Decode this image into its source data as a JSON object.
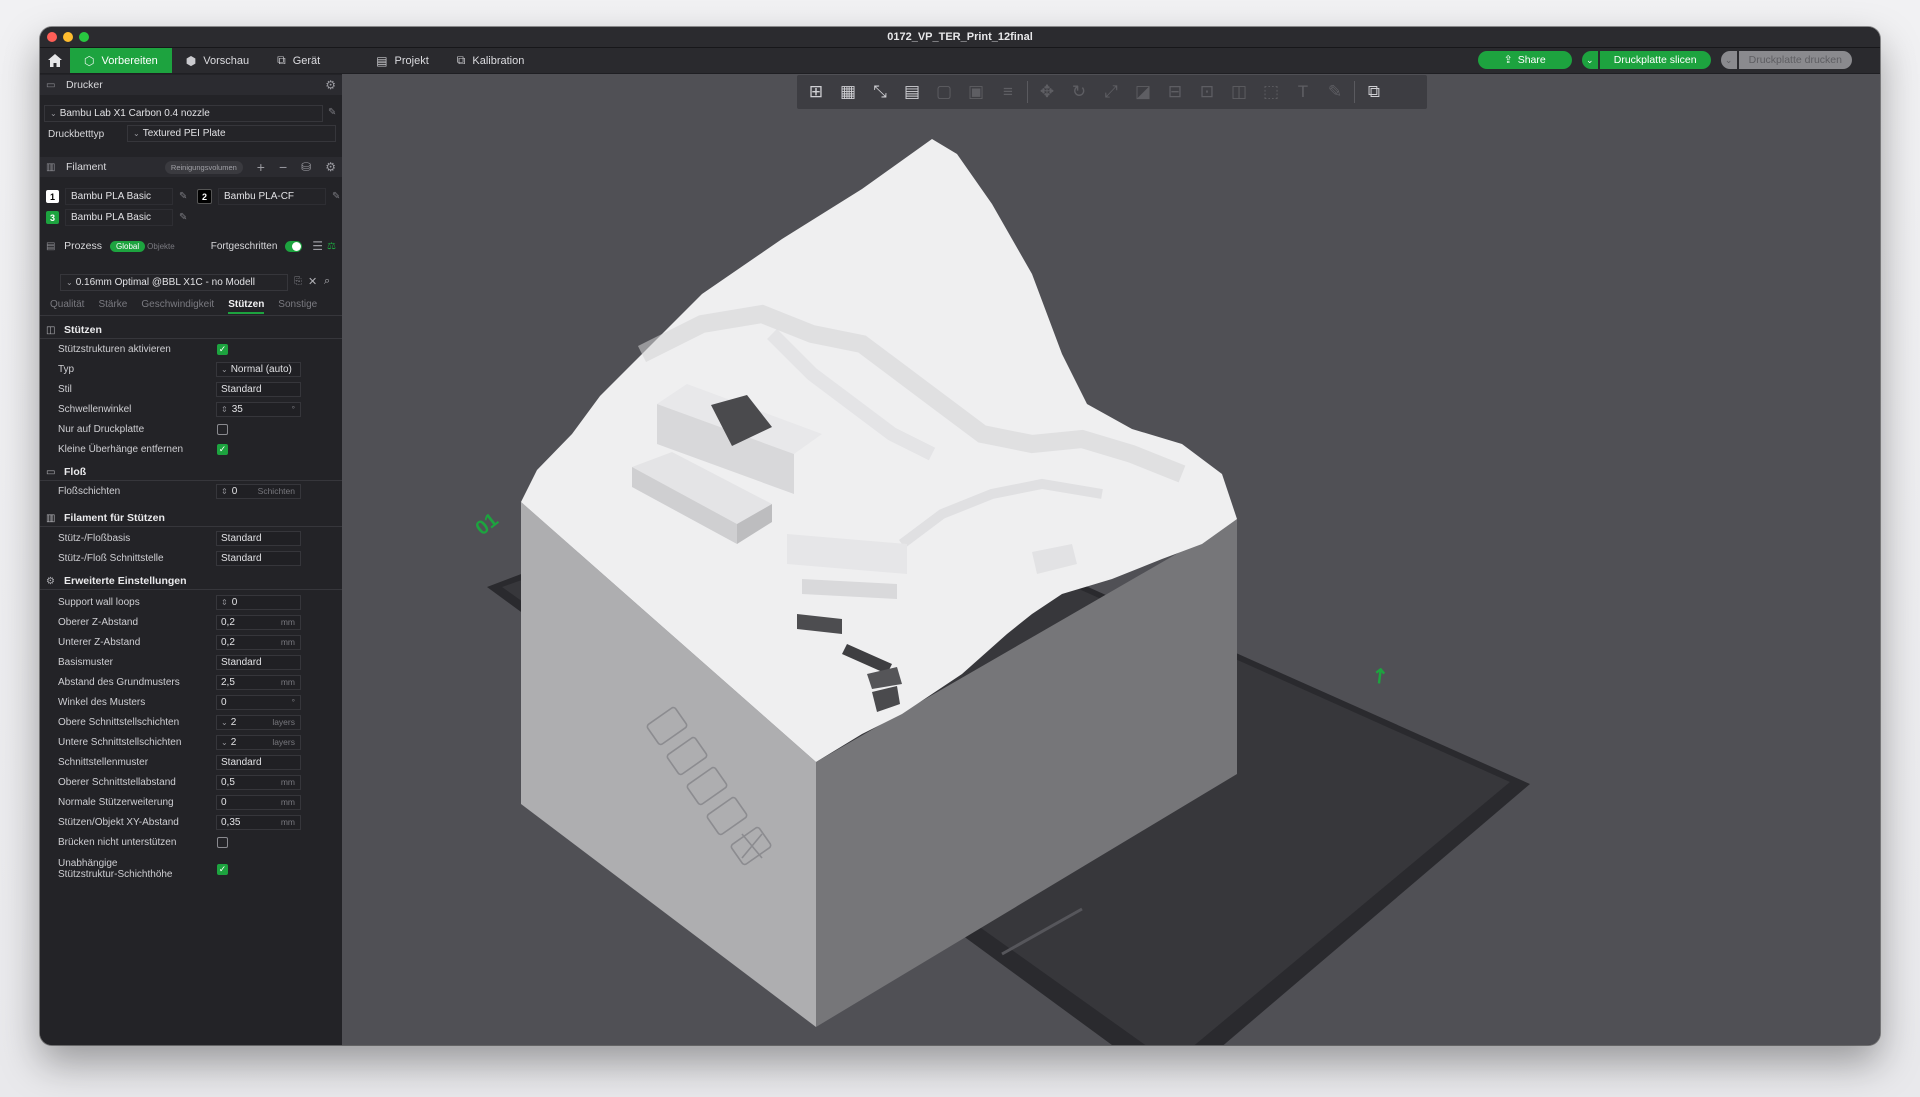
{
  "window": {
    "title": "0172_VP_TER_Print_12final"
  },
  "menu": {
    "tabs": [
      {
        "label": "Vorbereiten",
        "icon": "prepare-icon",
        "active": true
      },
      {
        "label": "Vorschau",
        "icon": "preview-icon"
      },
      {
        "label": "Gerät",
        "icon": "device-icon"
      },
      {
        "label": "Projekt",
        "icon": "project-icon"
      },
      {
        "label": "Kalibration",
        "icon": "calibration-icon"
      }
    ],
    "share": "Share",
    "slice": "Druckplatte slicen",
    "print": "Druckplatte drucken"
  },
  "printer": {
    "title": "Drucker",
    "model": "Bambu Lab X1 Carbon 0.4 nozzle",
    "bed_label": "Druckbetttyp",
    "bed_value": "Textured PEI Plate"
  },
  "filament": {
    "title": "Filament",
    "flush_button": "Reinigungsvolumen",
    "slots": [
      {
        "num": "1",
        "name": "Bambu PLA Basic",
        "color": "#ffffff",
        "text": "#000000"
      },
      {
        "num": "2",
        "name": "Bambu PLA-CF",
        "color": "#000000",
        "text": "#ffffff"
      },
      {
        "num": "3",
        "name": "Bambu PLA Basic",
        "color": "#1da33f",
        "text": "#ffffff"
      }
    ]
  },
  "process": {
    "title": "Prozess",
    "global": "Global",
    "objects": "Objekte",
    "advanced": "Fortgeschritten",
    "preset": "0.16mm Optimal @BBL X1C - no Modell",
    "tabs": [
      "Qualität",
      "Stärke",
      "Geschwindigkeit",
      "Stützen",
      "Sonstige"
    ],
    "active_tab": "Stützen"
  },
  "groups": {
    "supports": "Stützen",
    "raft": "Floß",
    "filament_support": "Filament für Stützen",
    "advanced": "Erweiterte Einstellungen"
  },
  "settings": {
    "enable_support": {
      "label": "Stützstrukturen aktivieren",
      "checked": true
    },
    "type": {
      "label": "Typ",
      "value": "Normal (auto)"
    },
    "style": {
      "label": "Stil",
      "value": "Standard"
    },
    "threshold": {
      "label": "Schwellenwinkel",
      "value": "35",
      "unit": "°"
    },
    "build_plate_only": {
      "label": "Nur auf Druckplatte",
      "checked": false
    },
    "remove_small": {
      "label": "Kleine Überhänge entfernen",
      "checked": true
    },
    "raft_layers": {
      "label": "Floßschichten",
      "value": "0",
      "unit": "Schichten"
    },
    "support_base": {
      "label": "Stütz-/Floßbasis",
      "value": "Standard"
    },
    "support_interface": {
      "label": "Stütz-/Floß Schnittstelle",
      "value": "Standard"
    },
    "wall_loops": {
      "label": "Support wall loops",
      "value": "0"
    },
    "top_z": {
      "label": "Oberer Z-Abstand",
      "value": "0,2",
      "unit": "mm"
    },
    "bottom_z": {
      "label": "Unterer Z-Abstand",
      "value": "0,2",
      "unit": "mm"
    },
    "base_pattern": {
      "label": "Basismuster",
      "value": "Standard"
    },
    "base_spacing": {
      "label": "Abstand des Grundmusters",
      "value": "2,5",
      "unit": "mm"
    },
    "pattern_angle": {
      "label": "Winkel des Musters",
      "value": "0",
      "unit": "°"
    },
    "top_interface": {
      "label": "Obere Schnittstellschichten",
      "value": "2",
      "unit": "layers"
    },
    "bottom_interface": {
      "label": "Untere Schnittstellschichten",
      "value": "2",
      "unit": "layers"
    },
    "interface_pattern": {
      "label": "Schnittstellenmuster",
      "value": "Standard"
    },
    "top_interface_spacing": {
      "label": "Oberer Schnittstellabstand",
      "value": "0,5",
      "unit": "mm"
    },
    "normal_expansion": {
      "label": "Normale Stützerweiterung",
      "value": "0",
      "unit": "mm"
    },
    "xy_distance": {
      "label": "Stützen/Objekt XY-Abstand",
      "value": "0,35",
      "unit": "mm"
    },
    "no_bridge": {
      "label": "Brücken nicht unterstützen",
      "checked": false
    },
    "independent_height_1": "Unabhängige",
    "independent_height_2": "Stützstruktur-Schichthöhe",
    "independent_height_checked": true
  },
  "viewport": {
    "plate_number": "01"
  },
  "colors": {
    "accent": "#1da33f",
    "panel": "#232327",
    "viewport": "#505055"
  }
}
